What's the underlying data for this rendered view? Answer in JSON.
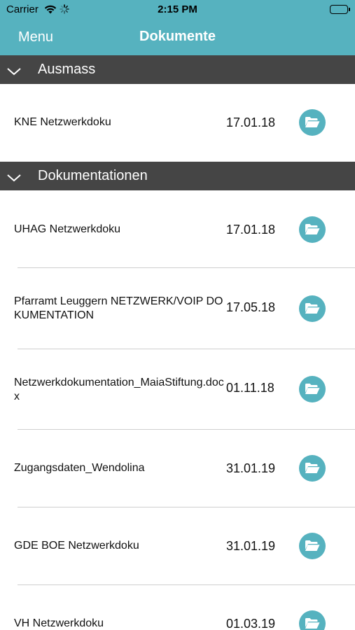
{
  "status_bar": {
    "carrier": "Carrier",
    "time": "2:15 PM"
  },
  "nav": {
    "menu_label": "Menu",
    "title": "Dokumente"
  },
  "colors": {
    "accent": "#56b2bf",
    "section_header": "#454545",
    "divider": "#cfcfcf"
  },
  "sections": [
    {
      "label": "Ausmass",
      "icon": "chevron-down-icon",
      "items": [
        {
          "name": "KNE Netzwerkdoku",
          "date": "17.01.18",
          "icon": "folder-open-icon"
        }
      ]
    },
    {
      "label": "Dokumentationen",
      "icon": "chevron-down-icon",
      "items": [
        {
          "name": "UHAG Netzwerkdoku",
          "date": "17.01.18",
          "icon": "folder-open-icon"
        },
        {
          "name": "Pfarramt Leuggern NETZWERK/VOIP DOKUMENTATION",
          "date": "17.05.18",
          "icon": "folder-open-icon"
        },
        {
          "name": "Netzwerkdokumentation_MaiaStiftung.docx",
          "date": "01.11.18",
          "icon": "folder-open-icon"
        },
        {
          "name": "Zugangsdaten_Wendolina",
          "date": "31.01.19",
          "icon": "folder-open-icon"
        },
        {
          "name": "GDE BOE Netzwerkdoku",
          "date": "31.01.19",
          "icon": "folder-open-icon"
        },
        {
          "name": "VH Netzwerkdoku",
          "date": "01.03.19",
          "icon": "folder-open-icon"
        }
      ]
    }
  ]
}
